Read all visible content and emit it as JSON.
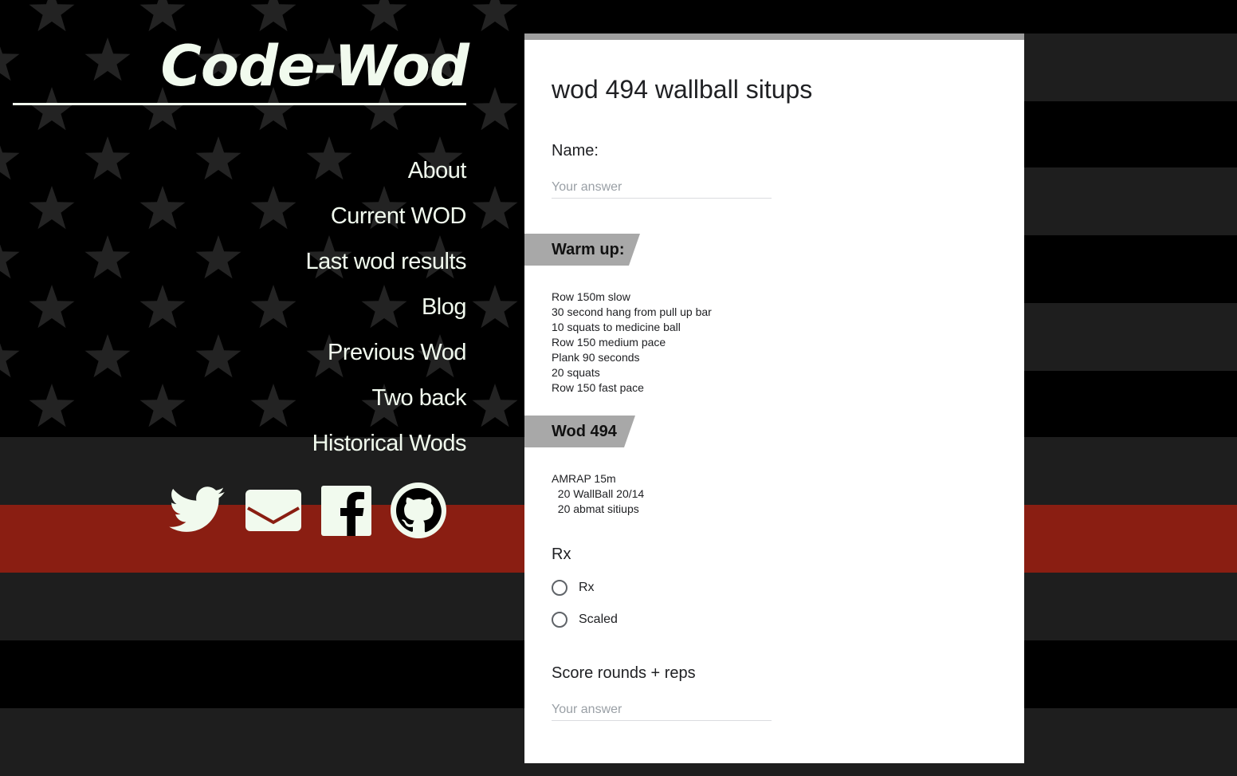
{
  "site": {
    "logo": "Code-Wod",
    "nav": [
      "About",
      "Current WOD",
      "Last wod results",
      "Blog",
      "Previous Wod",
      "Two back",
      "Historical Wods"
    ],
    "social": [
      "twitter-icon",
      "mail-icon",
      "facebook-icon",
      "github-icon"
    ]
  },
  "colors": {
    "flag_red": "#8a1e12",
    "flag_gray": "#1e1e1e",
    "text_light": "#f1faee",
    "section_gray": "#a8a8a8"
  },
  "form": {
    "title": "wod 494 wallball situps",
    "name_label": "Name:",
    "answer_placeholder": "Your answer",
    "warmup": {
      "heading": "Warm up:",
      "lines": "Row 150m slow\n30 second hang from pull up bar\n10 squats to medicine ball\nRow 150 medium pace\nPlank 90 seconds\n20 squats\nRow 150 fast pace"
    },
    "wod": {
      "heading": "Wod 494",
      "lines": "AMRAP 15m\n  20 WallBall 20/14\n  20 abmat sitiups"
    },
    "rx": {
      "label": "Rx",
      "options": [
        "Rx",
        "Scaled"
      ]
    },
    "score_label": "Score rounds + reps"
  }
}
